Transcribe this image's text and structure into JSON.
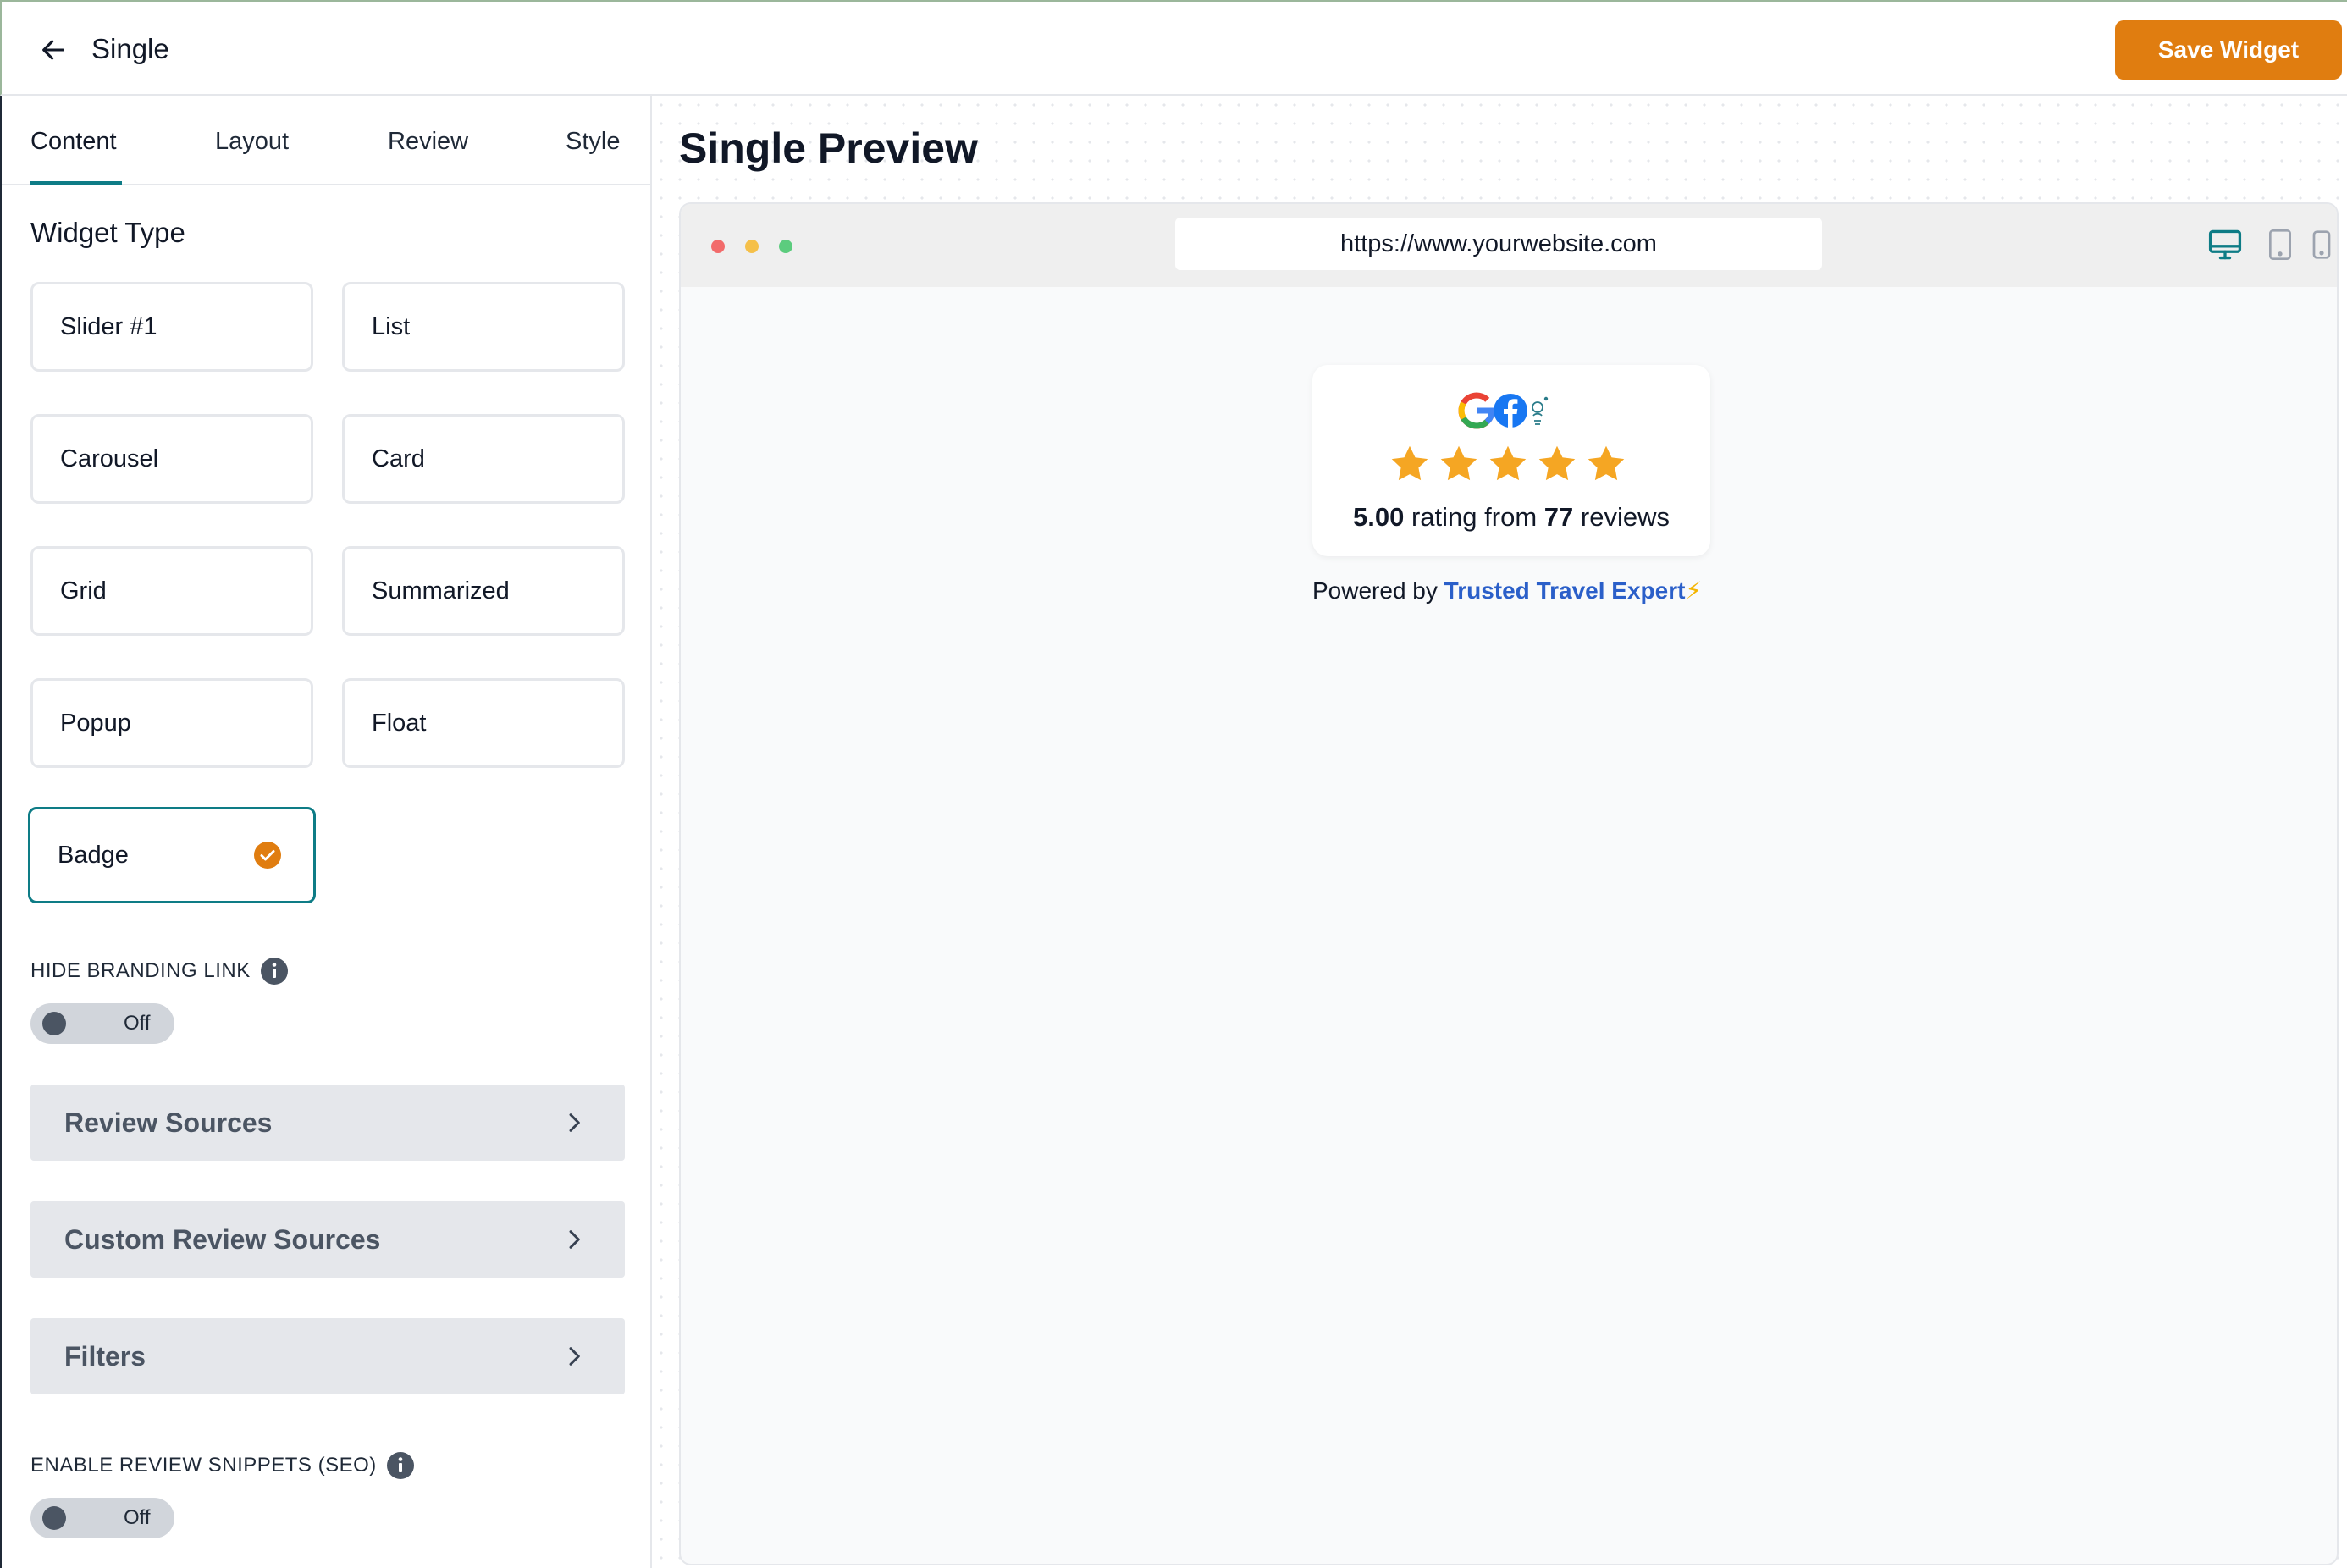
{
  "header": {
    "title": "Single",
    "save_label": "Save Widget"
  },
  "tabs": [
    {
      "label": "Content",
      "active": true
    },
    {
      "label": "Layout",
      "active": false
    },
    {
      "label": "Review",
      "active": false
    },
    {
      "label": "Style",
      "active": false
    }
  ],
  "widget_type": {
    "title": "Widget Type",
    "options": [
      {
        "label": "Slider #1"
      },
      {
        "label": "List"
      },
      {
        "label": "Carousel"
      },
      {
        "label": "Card"
      },
      {
        "label": "Grid"
      },
      {
        "label": "Summarized"
      },
      {
        "label": "Popup"
      },
      {
        "label": "Float"
      },
      {
        "label": "Badge",
        "selected": true
      }
    ]
  },
  "hide_branding": {
    "label": "HIDE BRANDING LINK",
    "toggle_text": "Off"
  },
  "accordions": [
    {
      "label": "Review Sources"
    },
    {
      "label": "Custom Review Sources"
    },
    {
      "label": "Filters"
    }
  ],
  "review_snippets": {
    "label": "ENABLE REVIEW SNIPPETS (SEO)",
    "toggle_text": "Off"
  },
  "preview": {
    "title": "Single Preview",
    "url": "https://www.yourwebsite.com",
    "badge": {
      "rating": "5.00",
      "rating_word": "rating from",
      "count": "77",
      "count_word": "reviews",
      "stars": 5
    },
    "powered_prefix": "Powered by",
    "powered_brand": "Trusted Travel Expert",
    "powered_suffix": "⚡"
  },
  "colors": {
    "accent": "#0e7c86",
    "save_button": "#e07d10",
    "star": "#f5a623",
    "brand_link": "#2b5fc9"
  }
}
